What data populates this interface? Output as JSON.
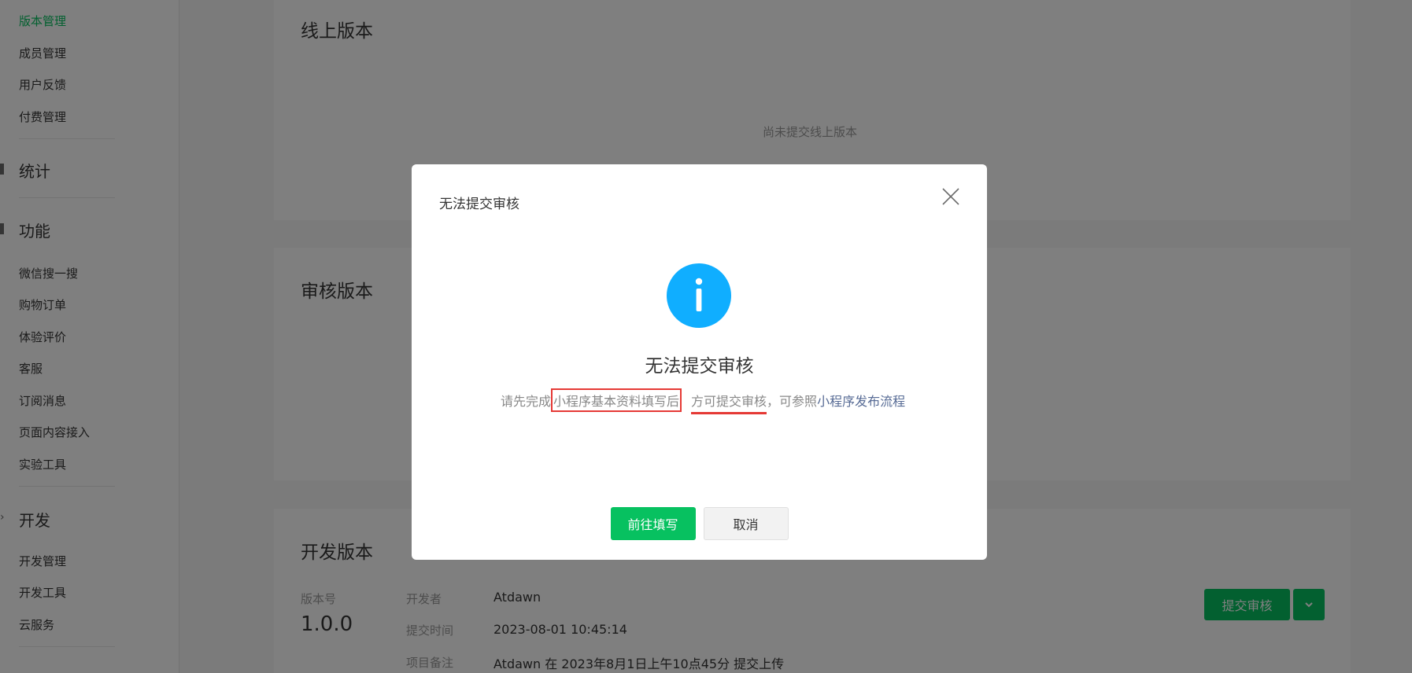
{
  "sidebar": {
    "active_item": "版本管理",
    "group1": [
      "成员管理",
      "用户反馈",
      "付费管理"
    ],
    "section_stats": "统计",
    "section_features": "功能",
    "features": [
      "微信搜一搜",
      "购物订单",
      "体验评价",
      "客服",
      "订阅消息",
      "页面内容接入",
      "实验工具"
    ],
    "section_dev": "开发",
    "dev": [
      "开发管理",
      "开发工具",
      "云服务"
    ]
  },
  "main": {
    "online_title": "线上版本",
    "online_empty": "尚未提交线上版本",
    "review_title": "审核版本",
    "dev_title": "开发版本",
    "version_label": "版本号",
    "version_value": "1.0.0",
    "developer_label": "开发者",
    "developer_value": "Atdawn",
    "submit_time_label": "提交时间",
    "submit_time_value": "2023-08-01 10:45:14",
    "note_label": "项目备注",
    "note_value": "Atdawn 在 2023年8月1日上午10点45分 提交上传",
    "submit_button": "提交审核"
  },
  "dialog": {
    "header": "无法提交审核",
    "title": "无法提交审核",
    "msg_prefix": "请先完成",
    "msg_boxed": "小程序基本资料填写后",
    "msg_underlined": "方可提交审核",
    "msg_mid": "，可参照",
    "msg_link": "小程序发布流程",
    "confirm_button": "前往填写",
    "cancel_button": "取消"
  },
  "colors": {
    "accent_green": "#07c160",
    "info_blue": "#10aeff",
    "link_blue": "#576b95",
    "annotation_red": "#e53935"
  }
}
